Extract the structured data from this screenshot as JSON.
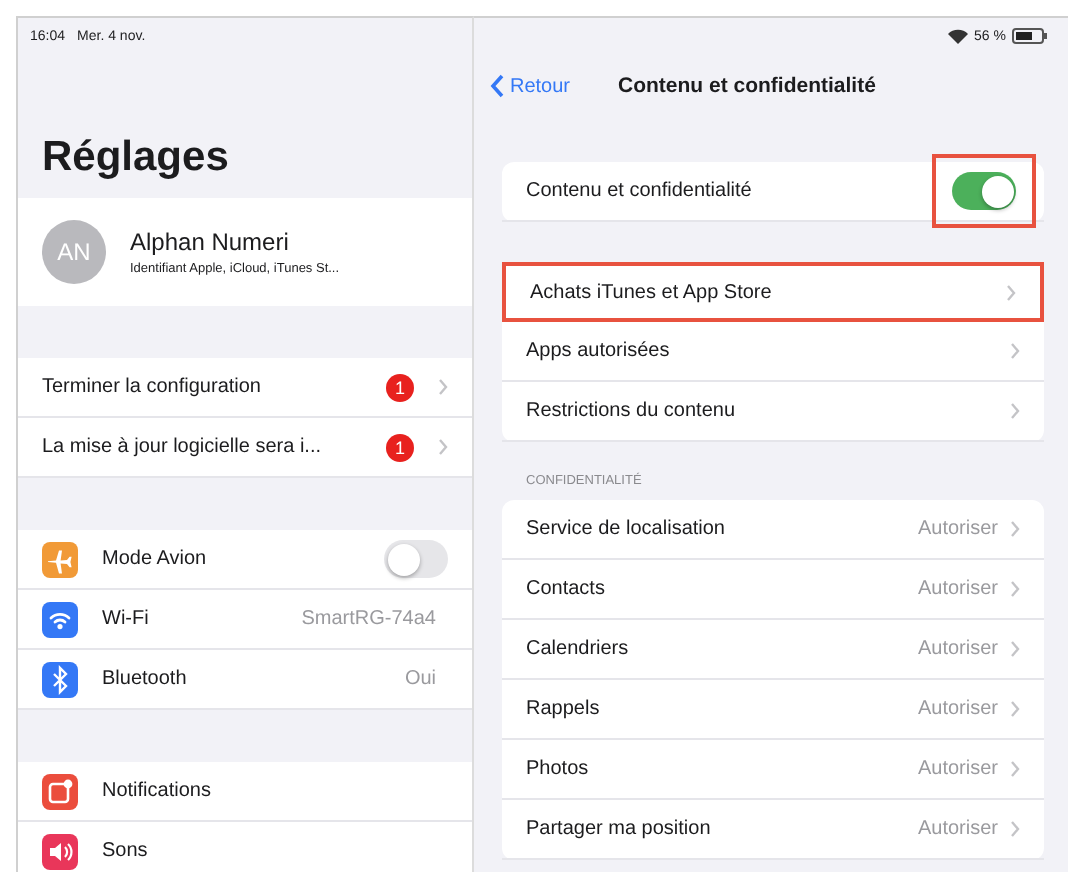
{
  "status_bar": {
    "time": "16:04",
    "date": "Mer. 4 nov.",
    "battery": "56 %"
  },
  "sidebar": {
    "title": "Réglages",
    "profile": {
      "initials": "AN",
      "name": "Alphan Numeri",
      "subtitle": "Identifiant Apple, iCloud, iTunes St..."
    },
    "alerts": [
      {
        "label": "Terminer la configuration",
        "badge": "1"
      },
      {
        "label": "La mise à jour logicielle sera i...",
        "badge": "1"
      }
    ],
    "connectivity": [
      {
        "kind": "toggle",
        "label": "Mode Avion",
        "color": "#f19a37",
        "on": false
      },
      {
        "kind": "value",
        "label": "Wi-Fi",
        "color": "#3478f6",
        "value": "SmartRG-74a4"
      },
      {
        "kind": "value",
        "label": "Bluetooth",
        "color": "#3478f6",
        "value": "Oui"
      }
    ],
    "system": [
      {
        "label": "Notifications",
        "color": "#eb4d3d"
      },
      {
        "label": "Sons",
        "color": "#e9365a"
      }
    ]
  },
  "nav": {
    "back": "Retour",
    "title": "Contenu et confidentialité"
  },
  "main_toggle": {
    "label": "Contenu et confidentialité",
    "on": true,
    "highlighted": true
  },
  "links": [
    {
      "label": "Achats iTunes et App Store",
      "highlighted": true
    },
    {
      "label": "Apps autorisées",
      "highlighted": false
    },
    {
      "label": "Restrictions du contenu",
      "highlighted": false
    }
  ],
  "privacy": {
    "header": "CONFIDENTIALITÉ",
    "items": [
      {
        "label": "Service de localisation",
        "value": "Autoriser"
      },
      {
        "label": "Contacts",
        "value": "Autoriser"
      },
      {
        "label": "Calendriers",
        "value": "Autoriser"
      },
      {
        "label": "Rappels",
        "value": "Autoriser"
      },
      {
        "label": "Photos",
        "value": "Autoriser"
      },
      {
        "label": "Partager ma position",
        "value": "Autoriser"
      }
    ]
  }
}
